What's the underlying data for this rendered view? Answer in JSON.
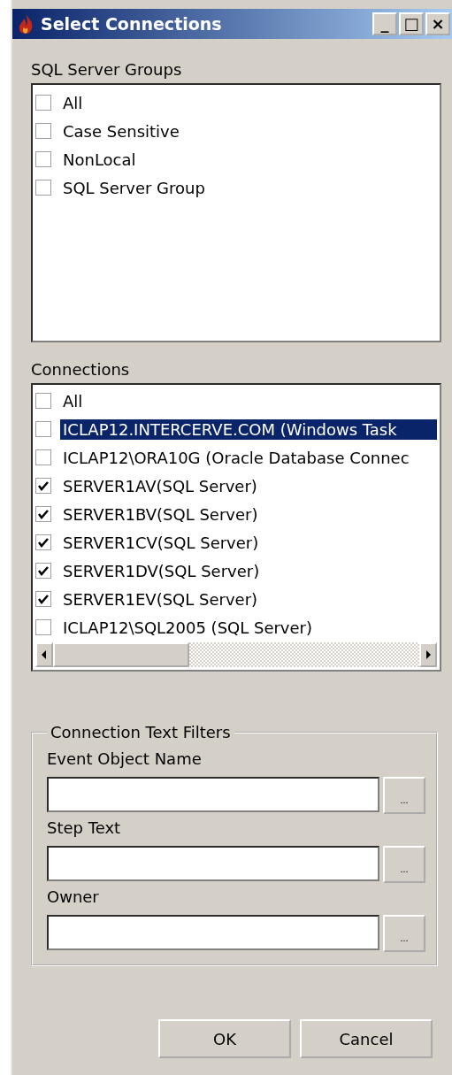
{
  "window": {
    "title": "Select Connections",
    "controls": [
      "_",
      "□",
      "×"
    ]
  },
  "groups": {
    "label": "SQL Server Groups",
    "items": [
      {
        "label": "All",
        "checked": false
      },
      {
        "label": "Case Sensitive",
        "checked": false
      },
      {
        "label": "NonLocal",
        "checked": false
      },
      {
        "label": "SQL Server Group",
        "checked": false
      }
    ]
  },
  "connections": {
    "label": "Connections",
    "items": [
      {
        "label": "All",
        "checked": false,
        "selected": false
      },
      {
        "label": "ICLAP12.INTERCERVE.COM (Windows Task",
        "checked": false,
        "selected": true
      },
      {
        "label": "ICLAP12\\ORA10G (Oracle Database Connec",
        "checked": false,
        "selected": false
      },
      {
        "label": "SERVER1AV(SQL Server)",
        "checked": true,
        "selected": false
      },
      {
        "label": "SERVER1BV(SQL Server)",
        "checked": true,
        "selected": false
      },
      {
        "label": "SERVER1CV(SQL Server)",
        "checked": true,
        "selected": false
      },
      {
        "label": "SERVER1DV(SQL Server)",
        "checked": true,
        "selected": false
      },
      {
        "label": "SERVER1EV(SQL Server)",
        "checked": true,
        "selected": false
      },
      {
        "label": "ICLAP12\\SQL2005 (SQL Server)",
        "checked": false,
        "selected": false
      }
    ]
  },
  "filters": {
    "legend": "Connection Text Filters",
    "fields": [
      {
        "label": "Event Object Name",
        "button": "..."
      },
      {
        "label": "Step Text",
        "button": "..."
      },
      {
        "label": "Owner",
        "button": "..."
      }
    ]
  },
  "buttons": [
    "OK",
    "Cancel"
  ]
}
